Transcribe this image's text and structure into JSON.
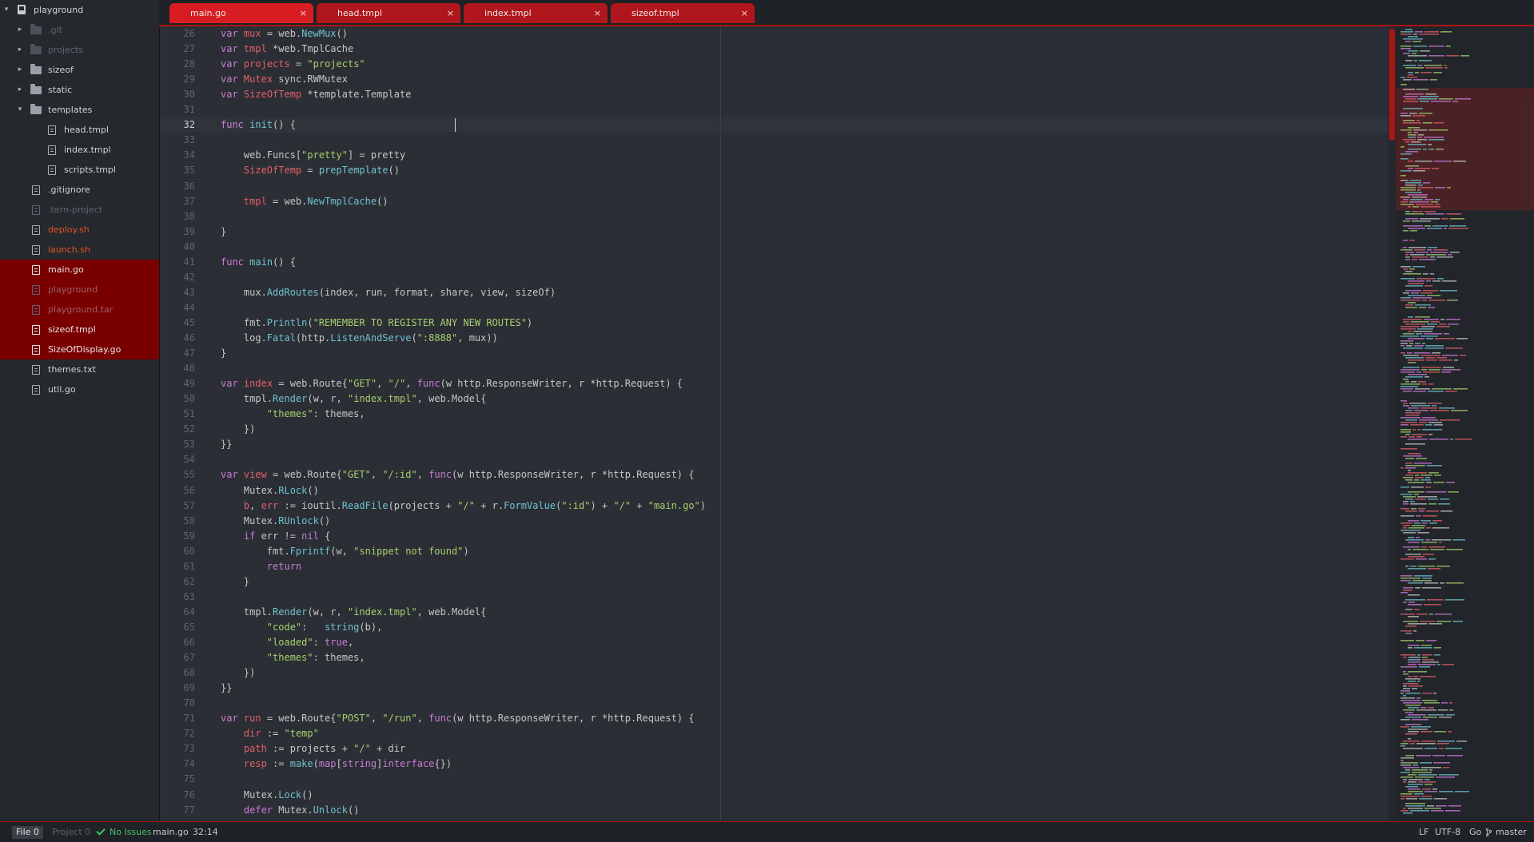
{
  "sidebar": {
    "root": "playground",
    "items": [
      {
        "label": "playground",
        "kind": "root",
        "expanded": true
      },
      {
        "label": ".git",
        "kind": "folder",
        "muted": true
      },
      {
        "label": "projects",
        "kind": "folder",
        "muted": true
      },
      {
        "label": "sizeof",
        "kind": "folder"
      },
      {
        "label": "static",
        "kind": "folder"
      },
      {
        "label": "templates",
        "kind": "folder",
        "expanded": true
      },
      {
        "label": "head.tmpl",
        "kind": "file"
      },
      {
        "label": "index.tmpl",
        "kind": "file"
      },
      {
        "label": "scripts.tmpl",
        "kind": "file"
      },
      {
        "label": ".gitignore",
        "kind": "file"
      },
      {
        "label": ".tern-project",
        "kind": "file",
        "muted": true
      },
      {
        "label": "deploy.sh",
        "kind": "file",
        "modified": true
      },
      {
        "label": "launch.sh",
        "kind": "file",
        "modified": true
      },
      {
        "label": "main.go",
        "kind": "file",
        "selected": true
      },
      {
        "label": "playground",
        "kind": "file",
        "selected": true,
        "muted": true
      },
      {
        "label": "playground.tar",
        "kind": "file",
        "selected": true,
        "muted": true
      },
      {
        "label": "sizeof.tmpl",
        "kind": "file",
        "selected": true
      },
      {
        "label": "SizeOfDisplay.go",
        "kind": "file",
        "selected": true
      },
      {
        "label": "themes.txt",
        "kind": "file"
      },
      {
        "label": "util.go",
        "kind": "file"
      }
    ]
  },
  "tabs": [
    {
      "label": "main.go",
      "active": true,
      "close": "×"
    },
    {
      "label": "head.tmpl",
      "active": false,
      "close": "×"
    },
    {
      "label": "index.tmpl",
      "active": false,
      "close": "×"
    },
    {
      "label": "sizeof.tmpl",
      "active": false,
      "close": "×"
    }
  ],
  "editor": {
    "current_line": 32,
    "lines": [
      {
        "n": "26",
        "tokens": [
          [
            "kw",
            "var"
          ],
          [
            "txt",
            " "
          ],
          [
            "var",
            "mux"
          ],
          [
            "txt",
            " = web."
          ],
          [
            "fn",
            "NewMux"
          ],
          [
            "txt",
            "()"
          ]
        ]
      },
      {
        "n": "27",
        "tokens": [
          [
            "kw",
            "var"
          ],
          [
            "txt",
            " "
          ],
          [
            "var",
            "tmpl"
          ],
          [
            "txt",
            " *web.TmplCache"
          ]
        ]
      },
      {
        "n": "28",
        "tokens": [
          [
            "kw",
            "var"
          ],
          [
            "txt",
            " "
          ],
          [
            "var",
            "projects"
          ],
          [
            "txt",
            " = "
          ],
          [
            "str",
            "\"projects\""
          ]
        ]
      },
      {
        "n": "29",
        "tokens": [
          [
            "kw",
            "var"
          ],
          [
            "txt",
            " "
          ],
          [
            "var",
            "Mutex"
          ],
          [
            "txt",
            " sync.RWMutex"
          ]
        ]
      },
      {
        "n": "30",
        "tokens": [
          [
            "kw",
            "var"
          ],
          [
            "txt",
            " "
          ],
          [
            "var",
            "SizeOfTemp"
          ],
          [
            "txt",
            " *template.Template"
          ]
        ]
      },
      {
        "n": "31",
        "tokens": []
      },
      {
        "n": "32",
        "tokens": [
          [
            "kw",
            "func"
          ],
          [
            "txt",
            " "
          ],
          [
            "fn",
            "init"
          ],
          [
            "txt",
            "() {"
          ]
        ]
      },
      {
        "n": "33",
        "tokens": []
      },
      {
        "n": "34",
        "tokens": [
          [
            "txt",
            "    web.Funcs["
          ],
          [
            "str",
            "\"pretty\""
          ],
          [
            "txt",
            "] = pretty"
          ]
        ]
      },
      {
        "n": "35",
        "tokens": [
          [
            "txt",
            "    "
          ],
          [
            "var",
            "SizeOfTemp"
          ],
          [
            "txt",
            " = "
          ],
          [
            "fn",
            "prepTemplate"
          ],
          [
            "txt",
            "()"
          ]
        ]
      },
      {
        "n": "36",
        "tokens": []
      },
      {
        "n": "37",
        "tokens": [
          [
            "txt",
            "    "
          ],
          [
            "var",
            "tmpl"
          ],
          [
            "txt",
            " = web."
          ],
          [
            "fn",
            "NewTmplCache"
          ],
          [
            "txt",
            "()"
          ]
        ]
      },
      {
        "n": "38",
        "tokens": []
      },
      {
        "n": "39",
        "tokens": [
          [
            "txt",
            "}"
          ]
        ]
      },
      {
        "n": "40",
        "tokens": []
      },
      {
        "n": "41",
        "tokens": [
          [
            "kw",
            "func"
          ],
          [
            "txt",
            " "
          ],
          [
            "fn",
            "main"
          ],
          [
            "txt",
            "() {"
          ]
        ]
      },
      {
        "n": "42",
        "tokens": []
      },
      {
        "n": "43",
        "tokens": [
          [
            "txt",
            "    mux."
          ],
          [
            "fn",
            "AddRoutes"
          ],
          [
            "txt",
            "(index, run, format, share, view, sizeOf)"
          ]
        ]
      },
      {
        "n": "44",
        "tokens": []
      },
      {
        "n": "45",
        "tokens": [
          [
            "txt",
            "    fmt."
          ],
          [
            "fn",
            "Println"
          ],
          [
            "txt",
            "("
          ],
          [
            "str",
            "\"REMEMBER TO REGISTER ANY NEW ROUTES\""
          ],
          [
            "txt",
            ")"
          ]
        ]
      },
      {
        "n": "46",
        "tokens": [
          [
            "txt",
            "    log."
          ],
          [
            "fn",
            "Fatal"
          ],
          [
            "txt",
            "(http."
          ],
          [
            "fn",
            "ListenAndServe"
          ],
          [
            "txt",
            "("
          ],
          [
            "str",
            "\":8888\""
          ],
          [
            "txt",
            ", mux))"
          ]
        ]
      },
      {
        "n": "47",
        "tokens": [
          [
            "txt",
            "}"
          ]
        ]
      },
      {
        "n": "48",
        "tokens": []
      },
      {
        "n": "49",
        "tokens": [
          [
            "kw",
            "var"
          ],
          [
            "txt",
            " "
          ],
          [
            "var",
            "index"
          ],
          [
            "txt",
            " = web.Route{"
          ],
          [
            "str",
            "\"GET\""
          ],
          [
            "txt",
            ", "
          ],
          [
            "str",
            "\"/\""
          ],
          [
            "txt",
            ", "
          ],
          [
            "kw",
            "func"
          ],
          [
            "txt",
            "(w http.ResponseWriter, r *http.Request) {"
          ]
        ]
      },
      {
        "n": "50",
        "tokens": [
          [
            "txt",
            "    tmpl."
          ],
          [
            "fn",
            "Render"
          ],
          [
            "txt",
            "(w, r, "
          ],
          [
            "str",
            "\"index.tmpl\""
          ],
          [
            "txt",
            ", web.Model{"
          ]
        ]
      },
      {
        "n": "51",
        "tokens": [
          [
            "txt",
            "        "
          ],
          [
            "str",
            "\"themes\""
          ],
          [
            "txt",
            ": themes,"
          ]
        ]
      },
      {
        "n": "52",
        "tokens": [
          [
            "txt",
            "    })"
          ]
        ]
      },
      {
        "n": "53",
        "tokens": [
          [
            "txt",
            "}}"
          ]
        ]
      },
      {
        "n": "54",
        "tokens": []
      },
      {
        "n": "55",
        "tokens": [
          [
            "kw",
            "var"
          ],
          [
            "txt",
            " "
          ],
          [
            "var",
            "view"
          ],
          [
            "txt",
            " = web.Route{"
          ],
          [
            "str",
            "\"GET\""
          ],
          [
            "txt",
            ", "
          ],
          [
            "str",
            "\"/:id\""
          ],
          [
            "txt",
            ", "
          ],
          [
            "kw",
            "func"
          ],
          [
            "txt",
            "(w http.ResponseWriter, r *http.Request) {"
          ]
        ]
      },
      {
        "n": "56",
        "tokens": [
          [
            "txt",
            "    Mutex."
          ],
          [
            "fn",
            "RLock"
          ],
          [
            "txt",
            "()"
          ]
        ]
      },
      {
        "n": "57",
        "tokens": [
          [
            "txt",
            "    "
          ],
          [
            "var",
            "b"
          ],
          [
            "txt",
            ", "
          ],
          [
            "var",
            "err"
          ],
          [
            "txt",
            " := ioutil."
          ],
          [
            "fn",
            "ReadFile"
          ],
          [
            "txt",
            "(projects + "
          ],
          [
            "str",
            "\"/\""
          ],
          [
            "txt",
            " + r."
          ],
          [
            "fn",
            "FormValue"
          ],
          [
            "txt",
            "("
          ],
          [
            "str",
            "\":id\""
          ],
          [
            "txt",
            ") + "
          ],
          [
            "str",
            "\"/\""
          ],
          [
            "txt",
            " + "
          ],
          [
            "str",
            "\"main.go\""
          ],
          [
            "txt",
            ")"
          ]
        ]
      },
      {
        "n": "58",
        "tokens": [
          [
            "txt",
            "    Mutex."
          ],
          [
            "fn",
            "RUnlock"
          ],
          [
            "txt",
            "()"
          ]
        ]
      },
      {
        "n": "59",
        "tokens": [
          [
            "txt",
            "    "
          ],
          [
            "kw",
            "if"
          ],
          [
            "txt",
            " err != "
          ],
          [
            "kw",
            "nil"
          ],
          [
            "txt",
            " {"
          ]
        ]
      },
      {
        "n": "60",
        "tokens": [
          [
            "txt",
            "        fmt."
          ],
          [
            "fn",
            "Fprintf"
          ],
          [
            "txt",
            "(w, "
          ],
          [
            "str",
            "\"snippet not found\""
          ],
          [
            "txt",
            ")"
          ]
        ]
      },
      {
        "n": "61",
        "tokens": [
          [
            "txt",
            "        "
          ],
          [
            "kw",
            "return"
          ]
        ]
      },
      {
        "n": "62",
        "tokens": [
          [
            "txt",
            "    }"
          ]
        ]
      },
      {
        "n": "63",
        "tokens": []
      },
      {
        "n": "64",
        "tokens": [
          [
            "txt",
            "    tmpl."
          ],
          [
            "fn",
            "Render"
          ],
          [
            "txt",
            "(w, r, "
          ],
          [
            "str",
            "\"index.tmpl\""
          ],
          [
            "txt",
            ", web.Model{"
          ]
        ]
      },
      {
        "n": "65",
        "tokens": [
          [
            "txt",
            "        "
          ],
          [
            "str",
            "\"code\""
          ],
          [
            "txt",
            ":   "
          ],
          [
            "fn",
            "string"
          ],
          [
            "txt",
            "(b),"
          ]
        ]
      },
      {
        "n": "66",
        "tokens": [
          [
            "txt",
            "        "
          ],
          [
            "str",
            "\"loaded\""
          ],
          [
            "txt",
            ": "
          ],
          [
            "kw",
            "true"
          ],
          [
            "txt",
            ","
          ]
        ]
      },
      {
        "n": "67",
        "tokens": [
          [
            "txt",
            "        "
          ],
          [
            "str",
            "\"themes\""
          ],
          [
            "txt",
            ": themes,"
          ]
        ]
      },
      {
        "n": "68",
        "tokens": [
          [
            "txt",
            "    })"
          ]
        ]
      },
      {
        "n": "69",
        "tokens": [
          [
            "txt",
            "}}"
          ]
        ]
      },
      {
        "n": "70",
        "tokens": []
      },
      {
        "n": "71",
        "tokens": [
          [
            "kw",
            "var"
          ],
          [
            "txt",
            " "
          ],
          [
            "var",
            "run"
          ],
          [
            "txt",
            " = web.Route{"
          ],
          [
            "str",
            "\"POST\""
          ],
          [
            "txt",
            ", "
          ],
          [
            "str",
            "\"/run\""
          ],
          [
            "txt",
            ", "
          ],
          [
            "kw",
            "func"
          ],
          [
            "txt",
            "(w http.ResponseWriter, r *http.Request) {"
          ]
        ]
      },
      {
        "n": "72",
        "tokens": [
          [
            "txt",
            "    "
          ],
          [
            "var",
            "dir"
          ],
          [
            "txt",
            " := "
          ],
          [
            "str",
            "\"temp\""
          ]
        ]
      },
      {
        "n": "73",
        "tokens": [
          [
            "txt",
            "    "
          ],
          [
            "var",
            "path"
          ],
          [
            "txt",
            " := projects + "
          ],
          [
            "str",
            "\"/\""
          ],
          [
            "txt",
            " + dir"
          ]
        ]
      },
      {
        "n": "74",
        "tokens": [
          [
            "txt",
            "    "
          ],
          [
            "var",
            "resp"
          ],
          [
            "txt",
            " := "
          ],
          [
            "fn",
            "make"
          ],
          [
            "txt",
            "("
          ],
          [
            "kw",
            "map"
          ],
          [
            "txt",
            "["
          ],
          [
            "kw",
            "string"
          ],
          [
            "txt",
            "]"
          ],
          [
            "kw",
            "interface"
          ],
          [
            "txt",
            "{})"
          ]
        ]
      },
      {
        "n": "75",
        "tokens": []
      },
      {
        "n": "76",
        "tokens": [
          [
            "txt",
            "    Mutex."
          ],
          [
            "fn",
            "Lock"
          ],
          [
            "txt",
            "()"
          ]
        ]
      },
      {
        "n": "77",
        "tokens": [
          [
            "txt",
            "    "
          ],
          [
            "kw",
            "defer"
          ],
          [
            "txt",
            " Mutex."
          ],
          [
            "fn",
            "Unlock"
          ],
          [
            "txt",
            "()"
          ]
        ]
      }
    ]
  },
  "statusbar": {
    "file_tab": "File 0",
    "project_tab": "Project 0",
    "issues": "No Issues",
    "filename": "main.go",
    "cursor": "32:14",
    "line_ending": "LF",
    "encoding": "UTF-8",
    "grammar": "Go",
    "branch": "master"
  },
  "colors": {
    "accent": "#d81d22",
    "selection": "#7a0000",
    "keyword": "#cc7bdb",
    "variable": "#e2606b",
    "string": "#a6d06f",
    "function": "#6ec2d1",
    "modified": "#e35322",
    "ok": "#3fc36a"
  }
}
